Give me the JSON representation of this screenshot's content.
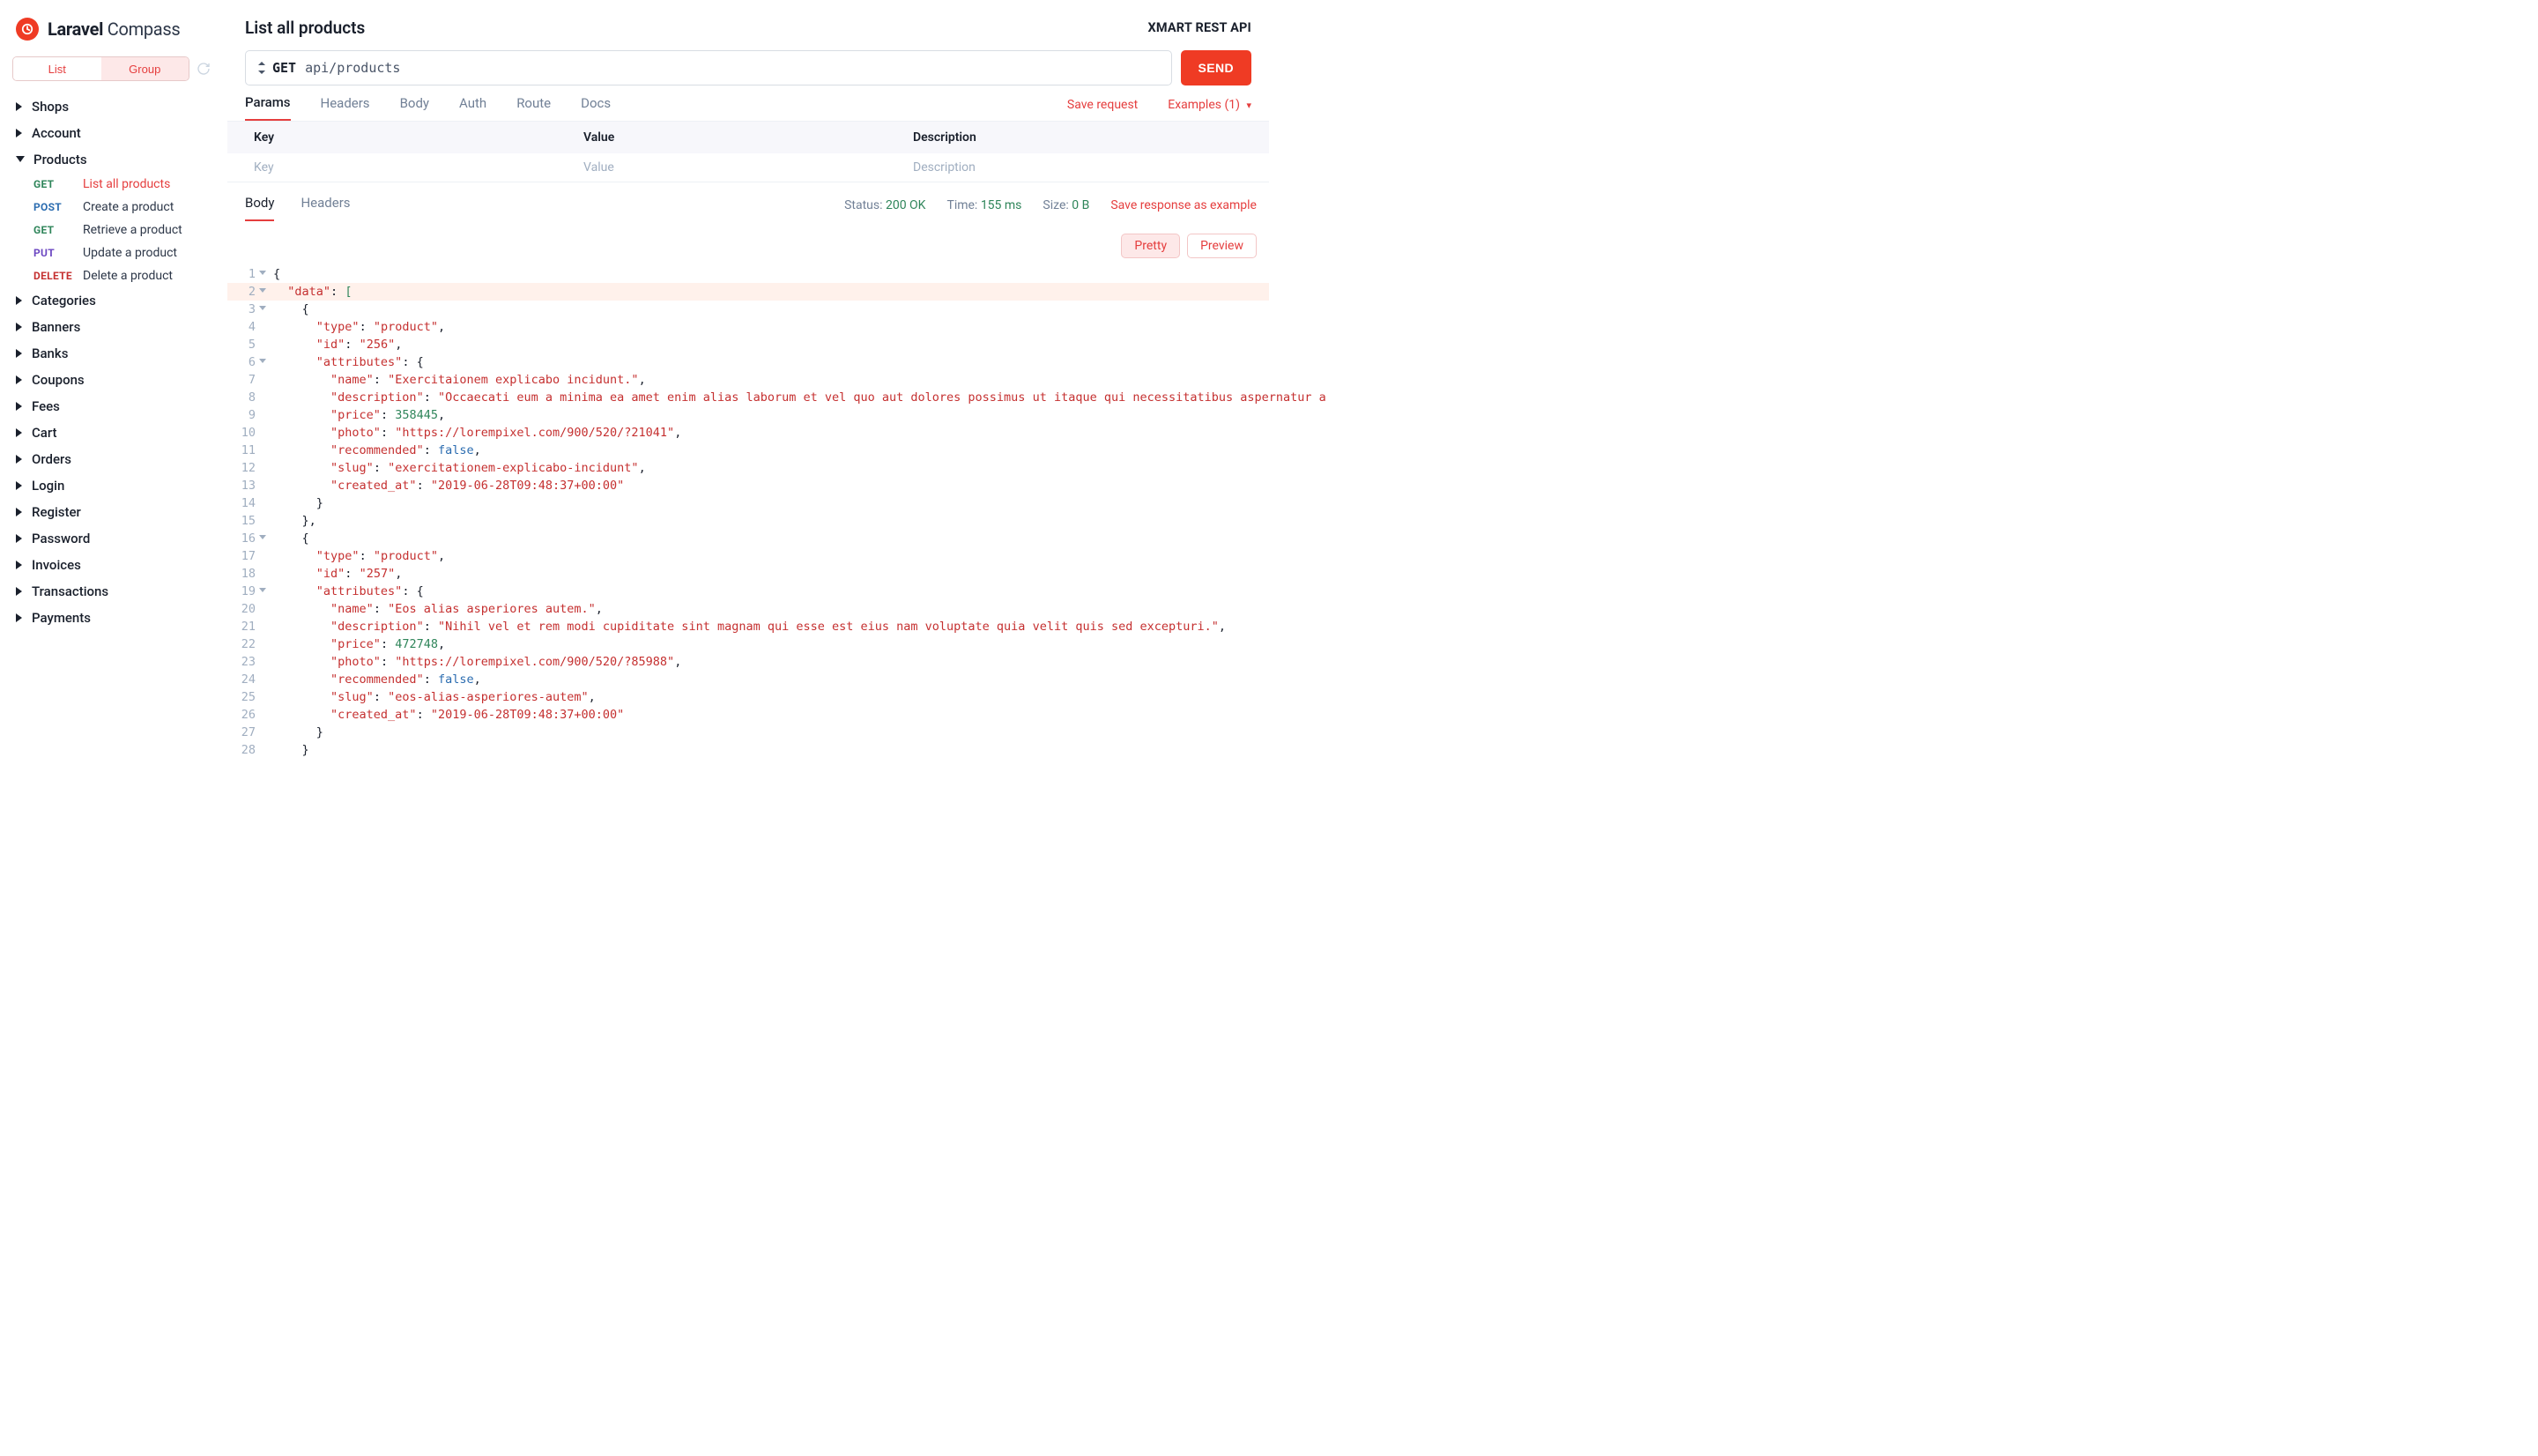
{
  "brand": {
    "bold": "Laravel",
    "light": "Compass"
  },
  "toggle": {
    "list": "List",
    "group": "Group"
  },
  "sidebar": {
    "items": [
      {
        "label": "Shops",
        "expanded": false
      },
      {
        "label": "Account",
        "expanded": false
      },
      {
        "label": "Products",
        "expanded": true,
        "children": [
          {
            "method": "GET",
            "label": "List all products",
            "active": true
          },
          {
            "method": "POST",
            "label": "Create a product"
          },
          {
            "method": "GET",
            "label": "Retrieve a product"
          },
          {
            "method": "PUT",
            "label": "Update a product"
          },
          {
            "method": "DELETE",
            "label": "Delete a product"
          }
        ]
      },
      {
        "label": "Categories",
        "expanded": false
      },
      {
        "label": "Banners",
        "expanded": false
      },
      {
        "label": "Banks",
        "expanded": false
      },
      {
        "label": "Coupons",
        "expanded": false
      },
      {
        "label": "Fees",
        "expanded": false
      },
      {
        "label": "Cart",
        "expanded": false
      },
      {
        "label": "Orders",
        "expanded": false
      },
      {
        "label": "Login",
        "expanded": false
      },
      {
        "label": "Register",
        "expanded": false
      },
      {
        "label": "Password",
        "expanded": false
      },
      {
        "label": "Invoices",
        "expanded": false
      },
      {
        "label": "Transactions",
        "expanded": false
      },
      {
        "label": "Payments",
        "expanded": false
      }
    ]
  },
  "header": {
    "title": "List all products",
    "api_name": "XMART REST API"
  },
  "request": {
    "method": "GET",
    "path": "api/products",
    "send": "SEND"
  },
  "req_tabs": [
    "Params",
    "Headers",
    "Body",
    "Auth",
    "Route",
    "Docs"
  ],
  "req_links": {
    "save": "Save request",
    "examples": "Examples (1)"
  },
  "params_table": {
    "headers": [
      "Key",
      "Value",
      "Description"
    ],
    "placeholders": [
      "Key",
      "Value",
      "Description"
    ]
  },
  "resp_tabs": [
    "Body",
    "Headers"
  ],
  "response_meta": {
    "status_label": "Status:",
    "status_value": "200 OK",
    "time_label": "Time:",
    "time_value": "155 ms",
    "size_label": "Size:",
    "size_value": "0 B",
    "save_link": "Save response as example"
  },
  "view": {
    "pretty": "Pretty",
    "preview": "Preview"
  },
  "code_lines": [
    {
      "n": 1,
      "fold": true,
      "html": "<span class='p'>{</span>"
    },
    {
      "n": 2,
      "fold": true,
      "hl": true,
      "html": "  <span class='k'>\"data\"</span><span class='p'>: </span><span class='br'>[</span>"
    },
    {
      "n": 3,
      "fold": true,
      "html": "    <span class='p'>{</span>"
    },
    {
      "n": 4,
      "html": "      <span class='k'>\"type\"</span><span class='p'>: </span><span class='s'>\"product\"</span><span class='p'>,</span>"
    },
    {
      "n": 5,
      "html": "      <span class='k'>\"id\"</span><span class='p'>: </span><span class='s'>\"256\"</span><span class='p'>,</span>"
    },
    {
      "n": 6,
      "fold": true,
      "html": "      <span class='k'>\"attributes\"</span><span class='p'>: {</span>"
    },
    {
      "n": 7,
      "html": "        <span class='k'>\"name\"</span><span class='p'>: </span><span class='s'>\"Exercitaionem explicabo incidunt.\"</span><span class='p'>,</span>"
    },
    {
      "n": 8,
      "html": "        <span class='k'>\"description\"</span><span class='p'>: </span><span class='s'>\"Occaecati eum a minima ea amet enim alias laborum et vel quo aut dolores possimus ut itaque qui necessitatibus aspernatur a</span>"
    },
    {
      "n": 9,
      "html": "        <span class='k'>\"price\"</span><span class='p'>: </span><span class='n'>358445</span><span class='p'>,</span>"
    },
    {
      "n": 10,
      "html": "        <span class='k'>\"photo\"</span><span class='p'>: </span><span class='s'>\"https://lorempixel.com/900/520/?21041\"</span><span class='p'>,</span>"
    },
    {
      "n": 11,
      "html": "        <span class='k'>\"recommended\"</span><span class='p'>: </span><span class='b'>false</span><span class='p'>,</span>"
    },
    {
      "n": 12,
      "html": "        <span class='k'>\"slug\"</span><span class='p'>: </span><span class='s'>\"exercitationem-explicabo-incidunt\"</span><span class='p'>,</span>"
    },
    {
      "n": 13,
      "html": "        <span class='k'>\"created_at\"</span><span class='p'>: </span><span class='s'>\"2019-06-28T09:48:37+00:00\"</span>"
    },
    {
      "n": 14,
      "html": "      <span class='p'>}</span>"
    },
    {
      "n": 15,
      "html": "    <span class='p'>},</span>"
    },
    {
      "n": 16,
      "fold": true,
      "html": "    <span class='p'>{</span>"
    },
    {
      "n": 17,
      "html": "      <span class='k'>\"type\"</span><span class='p'>: </span><span class='s'>\"product\"</span><span class='p'>,</span>"
    },
    {
      "n": 18,
      "html": "      <span class='k'>\"id\"</span><span class='p'>: </span><span class='s'>\"257\"</span><span class='p'>,</span>"
    },
    {
      "n": 19,
      "fold": true,
      "html": "      <span class='k'>\"attributes\"</span><span class='p'>: {</span>"
    },
    {
      "n": 20,
      "html": "        <span class='k'>\"name\"</span><span class='p'>: </span><span class='s'>\"Eos alias asperiores autem.\"</span><span class='p'>,</span>"
    },
    {
      "n": 21,
      "html": "        <span class='k'>\"description\"</span><span class='p'>: </span><span class='s'>\"Nihil vel et rem modi cupiditate sint magnam qui esse est eius nam voluptate quia velit quis sed excepturi.\"</span><span class='p'>,</span>"
    },
    {
      "n": 22,
      "html": "        <span class='k'>\"price\"</span><span class='p'>: </span><span class='n'>472748</span><span class='p'>,</span>"
    },
    {
      "n": 23,
      "html": "        <span class='k'>\"photo\"</span><span class='p'>: </span><span class='s'>\"https://lorempixel.com/900/520/?85988\"</span><span class='p'>,</span>"
    },
    {
      "n": 24,
      "html": "        <span class='k'>\"recommended\"</span><span class='p'>: </span><span class='b'>false</span><span class='p'>,</span>"
    },
    {
      "n": 25,
      "html": "        <span class='k'>\"slug\"</span><span class='p'>: </span><span class='s'>\"eos-alias-asperiores-autem\"</span><span class='p'>,</span>"
    },
    {
      "n": 26,
      "html": "        <span class='k'>\"created_at\"</span><span class='p'>: </span><span class='s'>\"2019-06-28T09:48:37+00:00\"</span>"
    },
    {
      "n": 27,
      "html": "      <span class='p'>}</span>"
    },
    {
      "n": 28,
      "html": "    <span class='p'>}</span>"
    }
  ]
}
